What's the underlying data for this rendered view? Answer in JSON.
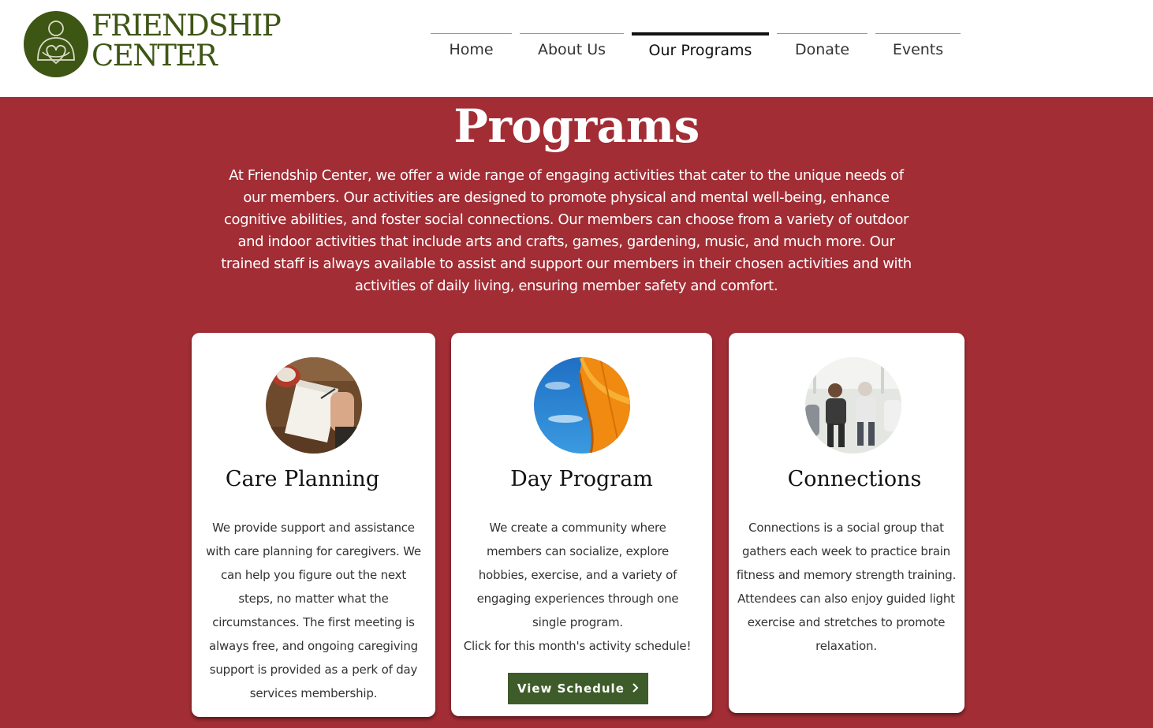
{
  "logo": {
    "line1": "FRIENDSHIP",
    "line2": "CENTER",
    "color": "#3e5614"
  },
  "nav": {
    "items": [
      "Home",
      "About Us",
      "Our Programs",
      "Donate",
      "Events"
    ],
    "active": "Our Programs"
  },
  "hero": {
    "title": "Programs",
    "description": "At Friendship Center, we offer a wide range of engaging activities that cater to the unique needs of our members. Our activities are designed to promote physical and mental well-being, enhance cognitive abilities, and foster social connections. Our members can choose from a variety of outdoor and indoor activities that include arts and crafts, games, gardening, music, and much more. Our trained staff is always available to assist and support our members in their chosen activities and with activities of daily living, ensuring member safety and comfort.",
    "background": "#a22d35"
  },
  "cards": [
    {
      "title": "Care Planning",
      "image_icon": "notebook-writing-photo",
      "description": "We provide support and assistance with care planning for caregivers. We can help you figure out the next steps, no matter what the circumstances. The first meeting is always free, and ongoing caregiving support is provided as a perk of day services membership."
    },
    {
      "title": "Day Program",
      "image_icon": "umbrella-sky-photo",
      "description": "We create a community where members can socialize, explore hobbies, exercise, and a variety of engaging experiences through one single program.",
      "description2": "Click for this month's activity schedule!",
      "button_label": "View Schedule",
      "button_icon": "chevron-right-icon"
    },
    {
      "title": "Connections",
      "image_icon": "group-seniors-photo",
      "description": "Connections is a social group that gathers each week to practice brain fitness and memory strength training. Attendees can also enjoy guided light exercise and stretches to promote relaxation."
    }
  ],
  "colors": {
    "button": "#3e5c2a",
    "nav_active": "#111111"
  }
}
